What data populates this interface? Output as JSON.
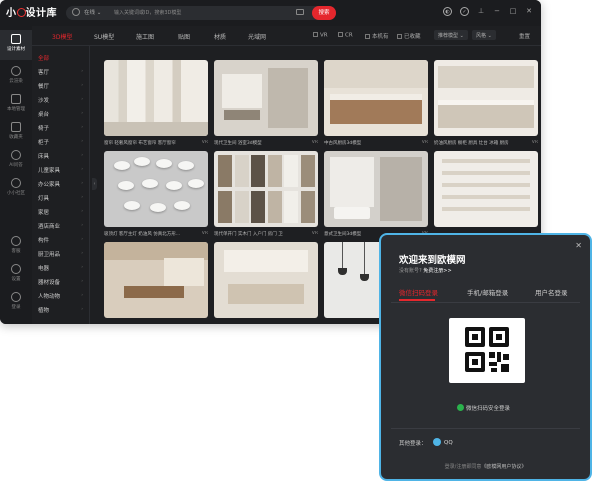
{
  "app": {
    "logo_text_a": "小",
    "logo_text_b": "设计库"
  },
  "search": {
    "scope": "在线 ⌄",
    "placeholder": "输入关键词或ID，搜索3D模型",
    "button": "搜索"
  },
  "rail": [
    {
      "label": "设计素材",
      "icon": "cube-icon",
      "active": true
    },
    {
      "label": "云渲染",
      "icon": "cloud-icon"
    },
    {
      "label": "本地管理",
      "icon": "folder-icon"
    },
    {
      "label": "收藏夹",
      "icon": "star-icon"
    },
    {
      "label": "AI问答",
      "icon": "ai-icon"
    },
    {
      "label": "小小社区",
      "icon": "community-icon"
    },
    {
      "label": "客服",
      "icon": "headset-icon"
    },
    {
      "label": "设置",
      "icon": "gear-icon"
    },
    {
      "label": "登录",
      "icon": "user-icon"
    }
  ],
  "tabs": [
    "3D模型",
    "SU模型",
    "施工图",
    "贴图",
    "材质",
    "光域网"
  ],
  "filters": [
    "VR",
    "CR",
    "本机有",
    "已收藏"
  ],
  "sort": [
    "推荐模型 ⌄",
    "风格 ⌄"
  ],
  "sort_reset": "重置",
  "categories": [
    "全部",
    "客厅",
    "餐厅",
    "沙发",
    "桌台",
    "椅子",
    "柜子",
    "床具",
    "儿童家具",
    "办公家具",
    "灯具",
    "家居",
    "酒店商业",
    "构件",
    "厨卫用品",
    "电器",
    "器材设备",
    "人物动物",
    "植物",
    "建筑外观"
  ],
  "cards": [
    {
      "caption": "窗帘 轻奢风窗帘 布艺窗帘 客厅窗帘",
      "tag": "VR"
    },
    {
      "caption": "现代卫生间 浴室3d模型",
      "tag": "VR"
    },
    {
      "caption": "中古风厨房3d模型",
      "tag": "VR"
    },
    {
      "caption": "奶油风厨房 橱柜 厨具 灶台 冰箱 厨房",
      "tag": "VR"
    },
    {
      "caption": "吸顶灯 客厅主灯 奶油风 仿真北方形...",
      "tag": "VR"
    },
    {
      "caption": "现代单开门 实木门 入户门 房门 卫",
      "tag": "VR"
    },
    {
      "caption": "意式卫生间3d模型",
      "tag": "VR"
    },
    {
      "caption": "",
      "tag": ""
    },
    {
      "caption": "",
      "tag": ""
    },
    {
      "caption": "",
      "tag": ""
    },
    {
      "caption": "",
      "tag": ""
    },
    {
      "caption": "",
      "tag": ""
    }
  ],
  "login": {
    "title": "欢迎来到欧模网",
    "sub_prefix": "没有账号?",
    "sub_link": "免费注册>>",
    "tabs": [
      "微信扫码登录",
      "手机/邮箱登录",
      "用户名登录"
    ],
    "wechat_hint": "微信扫码安全登录",
    "other_label": "其他登录：",
    "qq": "QQ",
    "foot_prefix": "登录/注册即同意",
    "foot_link": "《欧模网用户协议》"
  },
  "colors": {
    "accent": "#e5272d",
    "modal_border": "#4fb4e6",
    "wechat": "#2ab24c"
  }
}
